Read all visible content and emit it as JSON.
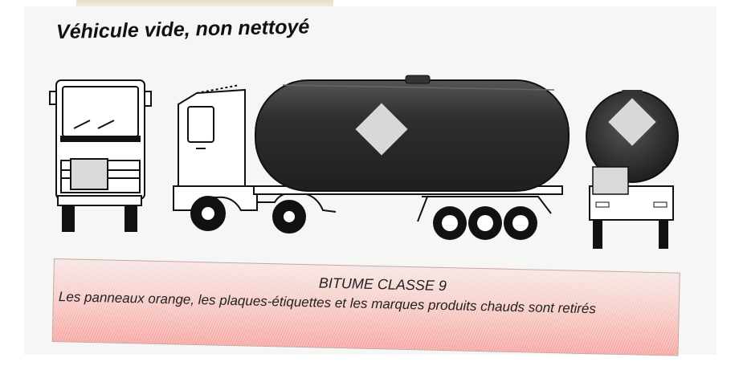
{
  "title": "Véhicule vide, non nettoyé",
  "notice": {
    "heading": "BITUME CLASSE 9",
    "text": "Les panneaux orange, les plaques-étiquettes et les marques produits chauds sont retirés"
  },
  "colors": {
    "tank": "#3a3a3a",
    "diamond": "#d8d8d8",
    "notice_gradient_end": "#f6a6a2"
  }
}
